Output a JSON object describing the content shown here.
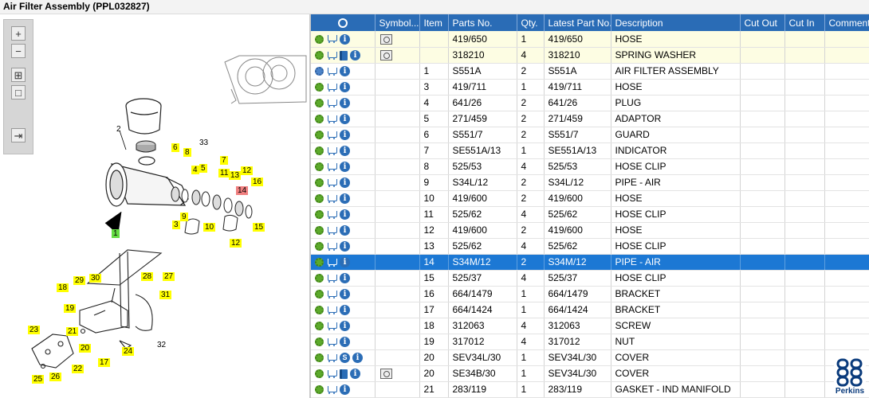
{
  "window": {
    "title": "Air Filter Assembly (PPL032827)"
  },
  "toolbar": {
    "zoom_in": "+",
    "zoom_out": "−",
    "fit": "⊞",
    "actual": "□",
    "export": "⇥"
  },
  "table": {
    "headers": {
      "icons": "",
      "symbol": "Symbol...",
      "item": "Item",
      "parts_no": "Parts No.",
      "qty": "Qty.",
      "latest": "Latest Part No.",
      "description": "Description",
      "cut_out": "Cut Out",
      "cut_in": "Cut In",
      "comment": "Comment"
    },
    "rows": [
      {
        "item": "",
        "parts_no": "419/650",
        "qty": "1",
        "latest": "419/650",
        "description": "HOSE",
        "cut_out": "",
        "cut_in": "",
        "comment": ""
      },
      {
        "item": "",
        "parts_no": "318210",
        "qty": "4",
        "latest": "318210",
        "description": "SPRING WASHER",
        "cut_out": "",
        "cut_in": "",
        "comment": ""
      },
      {
        "item": "1",
        "parts_no": "S551A",
        "qty": "2",
        "latest": "S551A",
        "description": "AIR FILTER ASSEMBLY",
        "cut_out": "",
        "cut_in": "",
        "comment": ""
      },
      {
        "item": "3",
        "parts_no": "419/711",
        "qty": "1",
        "latest": "419/711",
        "description": "HOSE",
        "cut_out": "",
        "cut_in": "",
        "comment": ""
      },
      {
        "item": "4",
        "parts_no": "641/26",
        "qty": "2",
        "latest": "641/26",
        "description": "PLUG",
        "cut_out": "",
        "cut_in": "",
        "comment": ""
      },
      {
        "item": "5",
        "parts_no": "271/459",
        "qty": "2",
        "latest": "271/459",
        "description": "ADAPTOR",
        "cut_out": "",
        "cut_in": "",
        "comment": ""
      },
      {
        "item": "6",
        "parts_no": "S551/7",
        "qty": "2",
        "latest": "S551/7",
        "description": "GUARD",
        "cut_out": "",
        "cut_in": "",
        "comment": ""
      },
      {
        "item": "7",
        "parts_no": "SE551A/13",
        "qty": "1",
        "latest": "SE551A/13",
        "description": "INDICATOR",
        "cut_out": "",
        "cut_in": "",
        "comment": ""
      },
      {
        "item": "8",
        "parts_no": "525/53",
        "qty": "4",
        "latest": "525/53",
        "description": "HOSE CLIP",
        "cut_out": "",
        "cut_in": "",
        "comment": ""
      },
      {
        "item": "9",
        "parts_no": "S34L/12",
        "qty": "2",
        "latest": "S34L/12",
        "description": "PIPE - AIR",
        "cut_out": "",
        "cut_in": "",
        "comment": ""
      },
      {
        "item": "10",
        "parts_no": "419/600",
        "qty": "2",
        "latest": "419/600",
        "description": "HOSE",
        "cut_out": "",
        "cut_in": "",
        "comment": ""
      },
      {
        "item": "11",
        "parts_no": "525/62",
        "qty": "4",
        "latest": "525/62",
        "description": "HOSE CLIP",
        "cut_out": "",
        "cut_in": "",
        "comment": ""
      },
      {
        "item": "12",
        "parts_no": "419/600",
        "qty": "2",
        "latest": "419/600",
        "description": "HOSE",
        "cut_out": "",
        "cut_in": "",
        "comment": ""
      },
      {
        "item": "13",
        "parts_no": "525/62",
        "qty": "4",
        "latest": "525/62",
        "description": "HOSE CLIP",
        "cut_out": "",
        "cut_in": "",
        "comment": ""
      },
      {
        "item": "14",
        "parts_no": "S34M/12",
        "qty": "2",
        "latest": "S34M/12",
        "description": "PIPE - AIR",
        "cut_out": "",
        "cut_in": "",
        "comment": ""
      },
      {
        "item": "15",
        "parts_no": "525/37",
        "qty": "4",
        "latest": "525/37",
        "description": "HOSE CLIP",
        "cut_out": "",
        "cut_in": "",
        "comment": ""
      },
      {
        "item": "16",
        "parts_no": "664/1479",
        "qty": "1",
        "latest": "664/1479",
        "description": "BRACKET",
        "cut_out": "",
        "cut_in": "",
        "comment": ""
      },
      {
        "item": "17",
        "parts_no": "664/1424",
        "qty": "1",
        "latest": "664/1424",
        "description": "BRACKET",
        "cut_out": "",
        "cut_in": "",
        "comment": ""
      },
      {
        "item": "18",
        "parts_no": "312063",
        "qty": "4",
        "latest": "312063",
        "description": "SCREW",
        "cut_out": "",
        "cut_in": "",
        "comment": ""
      },
      {
        "item": "19",
        "parts_no": "317012",
        "qty": "4",
        "latest": "317012",
        "description": "NUT",
        "cut_out": "",
        "cut_in": "",
        "comment": ""
      },
      {
        "item": "20",
        "parts_no": "SEV34L/30",
        "qty": "1",
        "latest": "SEV34L/30",
        "description": "COVER",
        "cut_out": "",
        "cut_in": "",
        "comment": ""
      },
      {
        "item": "20",
        "parts_no": "SE34B/30",
        "qty": "1",
        "latest": "SEV34L/30",
        "description": "COVER",
        "cut_out": "",
        "cut_in": "",
        "comment": ""
      },
      {
        "item": "21",
        "parts_no": "283/119",
        "qty": "1",
        "latest": "283/119",
        "description": "GASKET - IND MANIFOLD",
        "cut_out": "",
        "cut_in": "",
        "comment": ""
      }
    ],
    "selected_item": "14"
  },
  "diagram": {
    "callouts": [
      "1",
      "2",
      "3",
      "4",
      "5",
      "6",
      "7",
      "8",
      "9",
      "10",
      "11",
      "12",
      "12",
      "13",
      "14",
      "15",
      "16",
      "17",
      "18",
      "19",
      "20",
      "21",
      "22",
      "23",
      "24",
      "25",
      "26",
      "27",
      "28",
      "29",
      "30",
      "31",
      "32",
      "33"
    ]
  },
  "brand": {
    "name": "Perkins"
  },
  "colors": {
    "header": "#2a6cb6",
    "selection": "#1c78d4",
    "highlight_row": "#fdfde3",
    "callout": "#ffff00",
    "callout_selected": "#f08080",
    "callout_hover": "#66dd44"
  }
}
